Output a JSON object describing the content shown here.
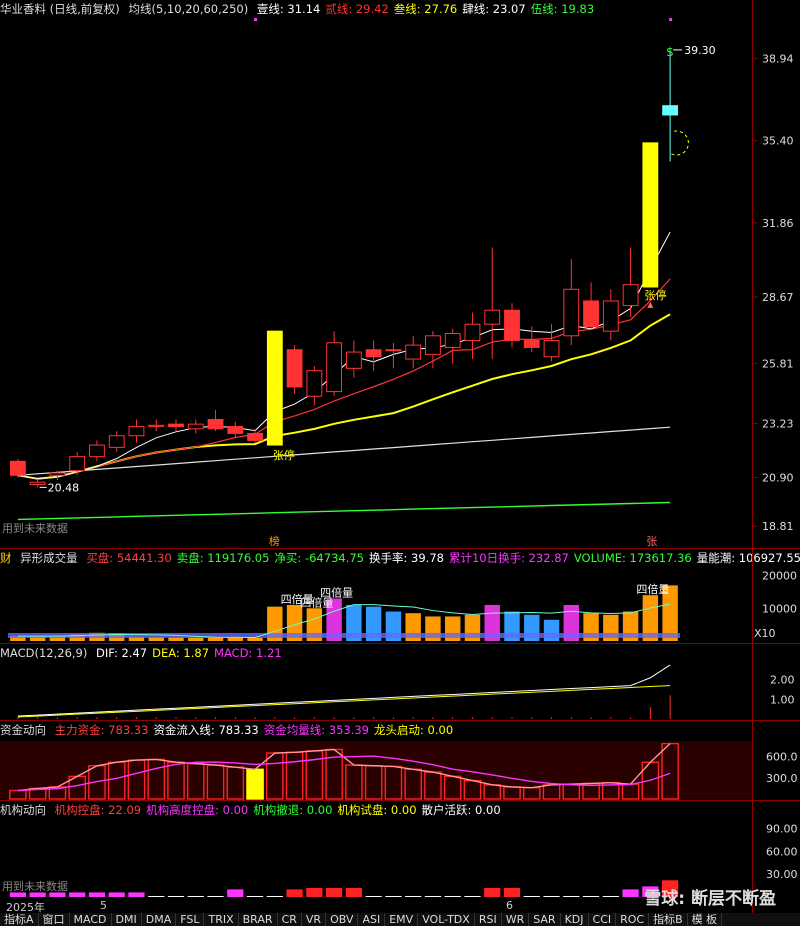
{
  "main": {
    "title": "华业香料 (日线,前复权)",
    "ma_label": "均线(5,10,20,60,250)",
    "ma_values": [
      {
        "label": "壹线: 31.14",
        "color": "#ffffff"
      },
      {
        "label": "贰线: 29.42",
        "color": "#ff3333"
      },
      {
        "label": "叁线: 27.76",
        "color": "#ffff00"
      },
      {
        "label": "肆线: 23.07",
        "color": "#ffffff"
      },
      {
        "label": "伍线: 19.83",
        "color": "#33ff33"
      }
    ],
    "yticks": [
      "38.94",
      "35.40",
      "31.86",
      "28.67",
      "25.81",
      "23.23",
      "20.90",
      "18.81"
    ],
    "ytick_values": [
      38.94,
      35.4,
      31.86,
      28.67,
      25.81,
      23.23,
      20.9,
      18.81
    ],
    "high_label": "39.30",
    "low_label": "20.48",
    "limit_up_1": "张停",
    "limit_up_2": "张停",
    "future_note": "用到未来数据",
    "bang": "榜",
    "zhang": "张",
    "cai": "财"
  },
  "volume": {
    "title": "异形成交量",
    "items": [
      {
        "label": "买盘: 54441.30",
        "color": "#ff4040"
      },
      {
        "label": "卖盘: 119176.05",
        "color": "#33ff33"
      },
      {
        "label": "净买: -64734.75",
        "color": "#33ff33"
      },
      {
        "label": "换手率: 39.78",
        "color": "#ffffff"
      },
      {
        "label": "累计10日换手: 232.87",
        "color": "#ff33ff"
      },
      {
        "label": "VOLUME: 173617.36",
        "color": "#33ff33"
      },
      {
        "label": "量能潮: 106927.55",
        "color": "#ffffff"
      }
    ],
    "yticks": [
      "20000",
      "10000"
    ],
    "unit": "X10",
    "beishu_label": "四倍量",
    "beishu_label2": "四倍量",
    "beishu_label3": "四倍量",
    "beishu_label4": "四倍量"
  },
  "macd": {
    "title": "MACD(12,26,9)",
    "items": [
      {
        "label": "DIF: 2.47",
        "color": "#ffffff"
      },
      {
        "label": "DEA: 1.87",
        "color": "#ffff00"
      },
      {
        "label": "MACD: 1.21",
        "color": "#ff33ff"
      }
    ],
    "yticks": [
      "2.00",
      "1.00"
    ]
  },
  "fund": {
    "title": "资金动向",
    "items": [
      {
        "label": "主力资金: 783.33",
        "color": "#ff4040"
      },
      {
        "label": "资金流入线: 783.33",
        "color": "#ffffff"
      },
      {
        "label": "资金均量线: 353.39",
        "color": "#ff33ff"
      },
      {
        "label": "龙头启动: 0.00",
        "color": "#ffff00"
      }
    ],
    "yticks": [
      "600.0",
      "300.0"
    ]
  },
  "inst": {
    "title": "机构动向",
    "items": [
      {
        "label": "机构控盘: 22.09",
        "color": "#ff4040"
      },
      {
        "label": "机构高度控盘: 0.00",
        "color": "#ff33ff"
      },
      {
        "label": "机构撤退: 0.00",
        "color": "#33ff33"
      },
      {
        "label": "机构试盘: 0.00",
        "color": "#ffff00"
      },
      {
        "label": "散户活跃: 0.00",
        "color": "#ffffff"
      }
    ],
    "yticks": [
      "90.00",
      "60.00",
      "30.00"
    ],
    "future_note": "用到未来数据"
  },
  "datebar": {
    "year": "2025年",
    "m5": "5",
    "m6": "6"
  },
  "watermark": "雪球: 断层不断盈",
  "tabs": [
    "指标A",
    "窗口",
    "MACD",
    "DMI",
    "DMA",
    "FSL",
    "TRIX",
    "BRAR",
    "CR",
    "VR",
    "OBV",
    "ASI",
    "EMV",
    "VOL-TDX",
    "RSI",
    "WR",
    "SAR",
    "KDJ",
    "CCI",
    "ROC",
    "指标B",
    "模 板"
  ],
  "chart_data": {
    "type": "candlestick",
    "title": "华业香料 (日线,前复权)",
    "ylim": [
      18.0,
      40.5
    ],
    "candles": [
      {
        "o": 21.6,
        "h": 21.7,
        "l": 20.9,
        "c": 21.0
      },
      {
        "o": 20.6,
        "h": 20.8,
        "l": 20.48,
        "c": 20.7
      },
      {
        "o": 21.0,
        "h": 21.2,
        "l": 20.8,
        "c": 21.1
      },
      {
        "o": 21.2,
        "h": 22.0,
        "l": 21.0,
        "c": 21.8
      },
      {
        "o": 21.8,
        "h": 22.5,
        "l": 21.6,
        "c": 22.3
      },
      {
        "o": 22.2,
        "h": 22.9,
        "l": 22.0,
        "c": 22.7
      },
      {
        "o": 22.7,
        "h": 23.4,
        "l": 22.4,
        "c": 23.1
      },
      {
        "o": 23.1,
        "h": 23.4,
        "l": 22.9,
        "c": 23.15
      },
      {
        "o": 23.2,
        "h": 23.4,
        "l": 22.9,
        "c": 23.1
      },
      {
        "o": 23.0,
        "h": 23.4,
        "l": 22.8,
        "c": 23.2
      },
      {
        "o": 23.4,
        "h": 23.8,
        "l": 22.9,
        "c": 23.0
      },
      {
        "o": 23.1,
        "h": 23.3,
        "l": 22.6,
        "c": 22.8
      },
      {
        "o": 22.8,
        "h": 23.0,
        "l": 22.4,
        "c": 22.5
      },
      {
        "o": 22.3,
        "h": 27.2,
        "l": 22.3,
        "c": 27.2
      },
      {
        "o": 26.4,
        "h": 26.6,
        "l": 24.5,
        "c": 24.8
      },
      {
        "o": 24.4,
        "h": 25.7,
        "l": 24.0,
        "c": 25.5
      },
      {
        "o": 24.6,
        "h": 27.2,
        "l": 24.4,
        "c": 26.7
      },
      {
        "o": 25.6,
        "h": 26.8,
        "l": 25.2,
        "c": 26.3
      },
      {
        "o": 26.4,
        "h": 26.8,
        "l": 25.5,
        "c": 26.1
      },
      {
        "o": 26.4,
        "h": 26.7,
        "l": 25.6,
        "c": 26.4
      },
      {
        "o": 26.0,
        "h": 27.0,
        "l": 25.6,
        "c": 26.6
      },
      {
        "o": 26.2,
        "h": 27.2,
        "l": 25.6,
        "c": 27.0
      },
      {
        "o": 26.5,
        "h": 27.3,
        "l": 25.8,
        "c": 27.1
      },
      {
        "o": 26.8,
        "h": 28.0,
        "l": 26.0,
        "c": 27.5
      },
      {
        "o": 27.5,
        "h": 30.8,
        "l": 26.0,
        "c": 28.1
      },
      {
        "o": 28.1,
        "h": 28.4,
        "l": 26.5,
        "c": 26.8
      },
      {
        "o": 26.8,
        "h": 27.4,
        "l": 26.3,
        "c": 26.5
      },
      {
        "o": 26.1,
        "h": 27.5,
        "l": 25.9,
        "c": 26.8
      },
      {
        "o": 27.0,
        "h": 30.3,
        "l": 26.6,
        "c": 29.0
      },
      {
        "o": 28.5,
        "h": 29.3,
        "l": 27.3,
        "c": 27.4
      },
      {
        "o": 27.2,
        "h": 29.0,
        "l": 26.8,
        "c": 28.5
      },
      {
        "o": 28.3,
        "h": 30.8,
        "l": 27.8,
        "c": 29.2
      },
      {
        "o": 29.1,
        "h": 35.3,
        "l": 29.1,
        "c": 35.3
      },
      {
        "o": 36.5,
        "h": 39.3,
        "l": 34.5,
        "c": 36.9
      }
    ]
  }
}
